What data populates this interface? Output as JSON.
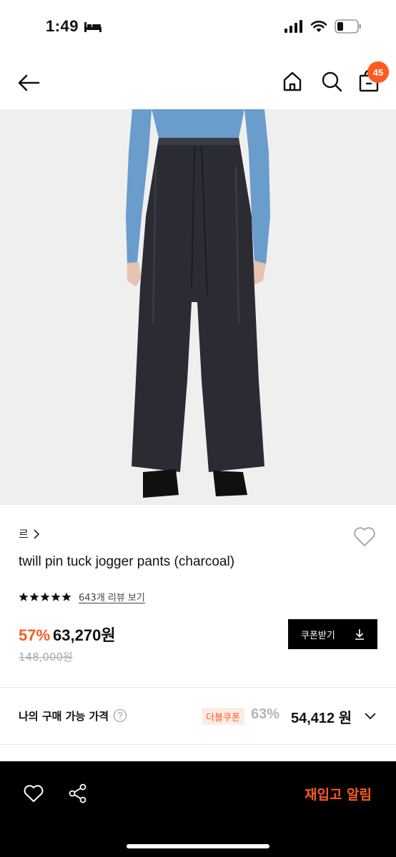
{
  "status_bar": {
    "time": "1:49",
    "icons": [
      "bed-icon",
      "signal-icon",
      "wifi-icon",
      "battery-icon"
    ]
  },
  "nav": {
    "cart_count": "45",
    "icons": [
      "back-arrow-icon",
      "home-icon",
      "search-icon",
      "bag-icon"
    ]
  },
  "product": {
    "brand": "르",
    "title": "twill pin tuck jogger pants (charcoal)",
    "rating_stars": 5,
    "review_link": "643개 리뷰 보기",
    "discount_rate": "57%",
    "price": "63,270원",
    "original_price": "148,000원",
    "coupon_button_label": "쿠폰받기"
  },
  "my_price": {
    "label": "나의 구매 가능 가격",
    "badge": "더블쿠폰",
    "discount_rate": "63%",
    "price": "54,412 원"
  },
  "bottom_bar": {
    "restock_label": "재입고 알림",
    "icons": [
      "heart-icon",
      "share-icon"
    ]
  },
  "colors": {
    "accent": "#ff5a1f",
    "bottom_bar": "#000000",
    "badge_bg": "#fdece6"
  }
}
